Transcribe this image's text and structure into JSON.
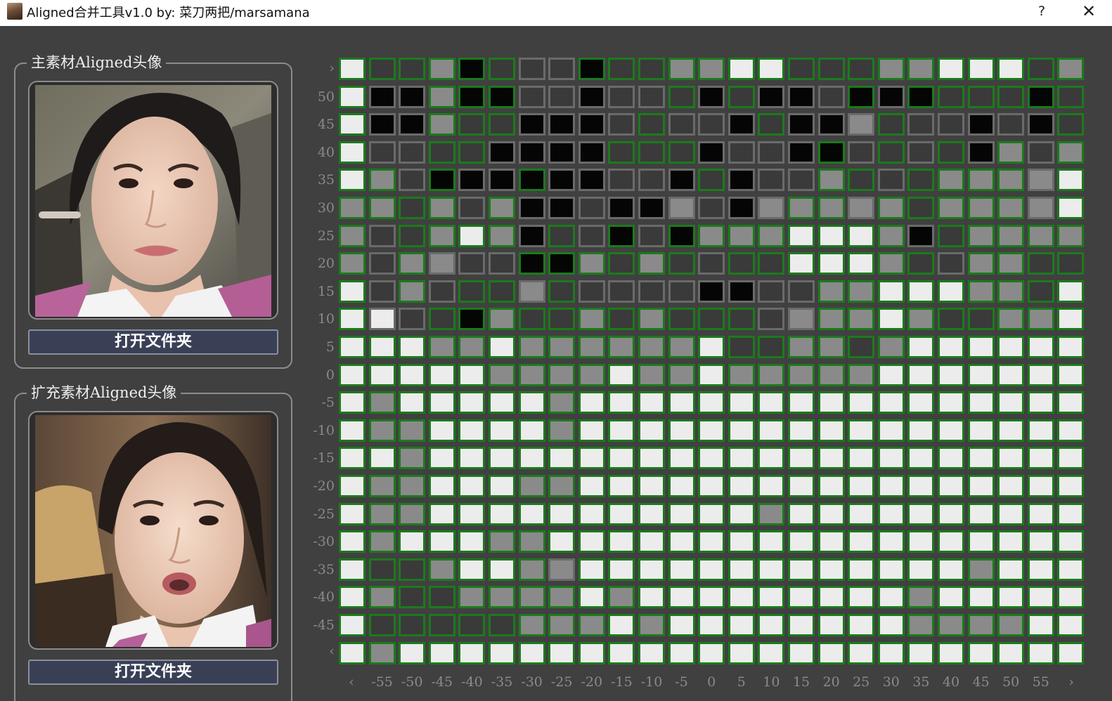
{
  "window": {
    "title": "Aligned合并工具v1.0  by: 菜刀两把/marsamana",
    "help_label": "?",
    "close_label": "✕"
  },
  "panels": [
    {
      "title": "主素材Aligned头像",
      "button_label": "打开文件夹"
    },
    {
      "title": "扩充素材Aligned头像",
      "button_label": "打开文件夹"
    }
  ],
  "grid": {
    "top_arrow": "›",
    "bottom_arrow": "‹",
    "left_arrow": "‹",
    "right_arrow": "›",
    "row_labels": [
      "50",
      "45",
      "40",
      "35",
      "30",
      "25",
      "20",
      "15",
      "10",
      "5",
      "0",
      "-5",
      "-10",
      "-15",
      "-20",
      "-25",
      "-30",
      "-35",
      "-40",
      "-45"
    ],
    "col_labels": [
      "-55",
      "-50",
      "-45",
      "-40",
      "-35",
      "-30",
      "-25",
      "-20",
      "-15",
      "-10",
      "-5",
      "0",
      "5",
      "10",
      "15",
      "20",
      "25",
      "30",
      "35",
      "40",
      "45",
      "50",
      "55"
    ],
    "legend": {
      "W": {
        "fill": "#ececec",
        "border": "#1c7a1c"
      },
      "w": {
        "fill": "#ececec",
        "border": "#6a6a6a"
      },
      "M": {
        "fill": "#8a8a8a",
        "border": "#1c7a1c"
      },
      "m": {
        "fill": "#8a8a8a",
        "border": "#6a6a6a"
      },
      "D": {
        "fill": "#3a3a3a",
        "border": "#1c7a1c"
      },
      "d": {
        "fill": "#3a3a3a",
        "border": "#6a6a6a"
      },
      "B": {
        "fill": "#050505",
        "border": "#1c7a1c"
      },
      "b": {
        "fill": "#050505",
        "border": "#6a6a6a"
      }
    },
    "rows": [
      "WDDMBDddBDDMMWWDDDMMWWWDM",
      "WbbMBBddbddDbDbbdBbBDDDBD",
      "WbbMDDbbbdDddbDbbmDddbdbD",
      "WddDDbbbbDDDbddbBdDdDbMdM",
      "WMdBbbBbbddbDbddMDdDMMMmW",
      "MMDMdMbbdbbmdbmMMmMDMMMmW",
      "MdDMWMbDdBdBMMMWWWMbDMMMM",
      "MdMmddBBMDMDdDDWWWMDdMMDD",
      "WdMdDDmDddddbbddMMWWWMMDW",
      "WwdDBMDDMDMDDDdmMMWMDDMMW",
      "WWWMMWMMMMMMWDDMMDMWWWWWW",
      "WWWWWMMMMWMMWMMMMMWWWWWWW",
      "WMWWWWWMWWWWWWWWWWWWWWWWW",
      "WMMWWWWMWWWWWWWWWWWWWWWWW",
      "WWMWWWWWWWWWWWWWWWWWWWWWW",
      "WMMWWWMMWWWWWWWWWWWWWWWWW",
      "WMMWWWWWWWWWWWMWWWWWWWWWW",
      "WMWWWMMWWWWWWWWWWWWWWWWWW",
      "WDDMWWMmWWWWWWWWWWWWWMWWW",
      "WMDDMMMMWMWWWWWWWWWMWWWWW",
      "WDDDDDMMMWMWWWWWWWWMMMMWW",
      "WMWWWWWWWWWWWWWWWWWWWWWWW"
    ]
  }
}
